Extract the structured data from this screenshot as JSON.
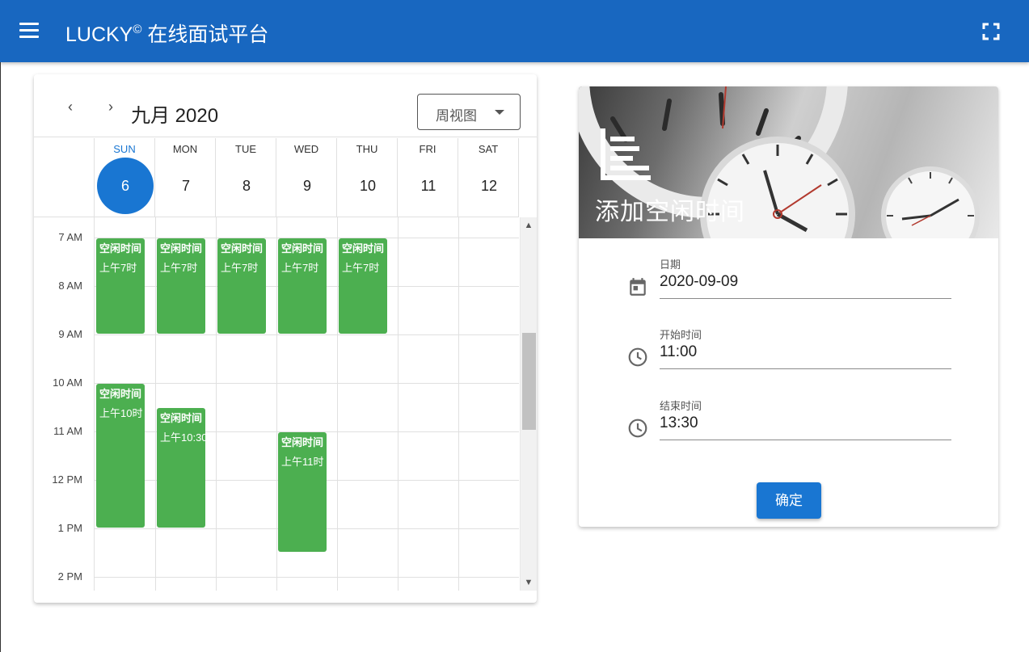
{
  "app": {
    "title_brand": "LUCKY",
    "title_mark": "©",
    "title_rest": " 在线面试平台"
  },
  "calendar": {
    "month_label": "九月 2020",
    "view_select": "周视图",
    "prev_icon": "‹",
    "next_icon": "›",
    "days": [
      {
        "weekday": "SUN",
        "date": "6"
      },
      {
        "weekday": "MON",
        "date": "7"
      },
      {
        "weekday": "TUE",
        "date": "8"
      },
      {
        "weekday": "WED",
        "date": "9"
      },
      {
        "weekday": "THU",
        "date": "10"
      },
      {
        "weekday": "FRI",
        "date": "11"
      },
      {
        "weekday": "SAT",
        "date": "12"
      }
    ],
    "today_index": 0,
    "hours": [
      "7 AM",
      "8 AM",
      "9 AM",
      "10 AM",
      "11 AM",
      "12 PM",
      "1 PM",
      "2 PM"
    ],
    "events": [
      {
        "day": 0,
        "start": 7.0,
        "end": 9.0,
        "title": "空闲时间",
        "time": "上午7时"
      },
      {
        "day": 1,
        "start": 7.0,
        "end": 9.0,
        "title": "空闲时间",
        "time": "上午7时"
      },
      {
        "day": 2,
        "start": 7.0,
        "end": 9.0,
        "title": "空闲时间",
        "time": "上午7时"
      },
      {
        "day": 3,
        "start": 7.0,
        "end": 9.0,
        "title": "空闲时间",
        "time": "上午7时"
      },
      {
        "day": 4,
        "start": 7.0,
        "end": 9.0,
        "title": "空闲时间",
        "time": "上午7时"
      },
      {
        "day": 0,
        "start": 10.0,
        "end": 13.0,
        "title": "空闲时间",
        "time": "上午10时"
      },
      {
        "day": 1,
        "start": 10.5,
        "end": 13.0,
        "title": "空闲时间",
        "time": "上午10:30"
      },
      {
        "day": 3,
        "start": 11.0,
        "end": 13.5,
        "title": "空闲时间",
        "time": "上午11时"
      }
    ],
    "event_color": "#4caf50",
    "today_color": "#1976d2"
  },
  "add_panel": {
    "title": "添加空闲时间",
    "date_label": "日期",
    "date_value": "2020-09-09",
    "start_label": "开始时间",
    "start_value": "11:00",
    "end_label": "结束时间",
    "end_value": "13:30",
    "confirm_label": "确定"
  },
  "colors": {
    "appbar": "#1867c0",
    "primary": "#1976d2"
  }
}
